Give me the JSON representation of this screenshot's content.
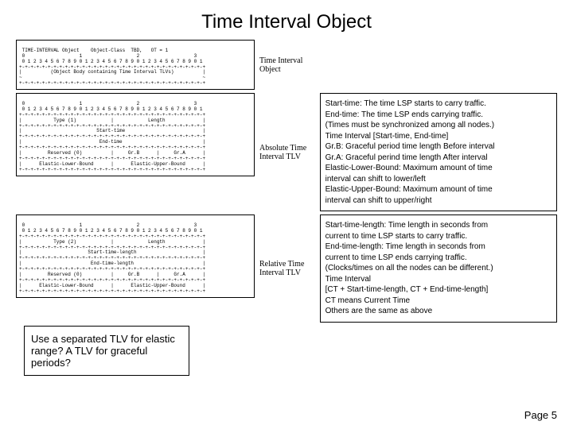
{
  "title": "Time Interval Object",
  "diag1": {
    "header": " TIME-INTERVAL Object    Object-Class  TBD,   OT = 1",
    "ruler1": " 0                   1                   2                   3",
    "ruler2": " 0 1 2 3 4 5 6 7 8 9 0 1 2 3 4 5 6 7 8 9 0 1 2 3 4 5 6 7 8 9 0 1",
    "sep": "+-+-+-+-+-+-+-+-+-+-+-+-+-+-+-+-+-+-+-+-+-+-+-+-+-+-+-+-+-+-+-+-+",
    "body": "|          (Object Body containing Time Interval TLVs)          |",
    "cont": "~                                                               ~",
    "label": "Time Interval\nObject"
  },
  "diag2": {
    "ruler1": " 0                   1                   2                   3",
    "ruler2": " 0 1 2 3 4 5 6 7 8 9 0 1 2 3 4 5 6 7 8 9 0 1 2 3 4 5 6 7 8 9 0 1",
    "sep": "+-+-+-+-+-+-+-+-+-+-+-+-+-+-+-+-+-+-+-+-+-+-+-+-+-+-+-+-+-+-+-+-+",
    "r1": "|           Type (1)            |            Length             |",
    "r2": "|                          Start-time                           |",
    "r3": "|                           End-time                            |",
    "r4": "|         Reserved (0)          |     Gr.B      |     Gr.A      |",
    "r5": "|      Elastic-Lower-Bound      |      Elastic-Upper-Bound      |",
    "label": "Absolute Time\nInterval TLV"
  },
  "note2": "Start-time: The time LSP starts to carry traffic.\nEnd-time: The time LSP ends carrying traffic.\n(Times must be synchronized among all nodes.)\n   Time Interval  [Start-time, End-time]\nGr.B: Graceful period time length Before interval\nGr.A: Graceful perind time length After interval\nElastic-Lower-Bound: Maximum amount of time\ninterval can shift to lower/left\nElastic-Upper-Bound: Maximum amount of time\ninterval can shift to upper/right",
  "diag3": {
    "ruler1": " 0                   1                   2                   3",
    "ruler2": " 0 1 2 3 4 5 6 7 8 9 0 1 2 3 4 5 6 7 8 9 0 1 2 3 4 5 6 7 8 9 0 1",
    "sep": "+-+-+-+-+-+-+-+-+-+-+-+-+-+-+-+-+-+-+-+-+-+-+-+-+-+-+-+-+-+-+-+-+",
    "r1": "|           Type (2)            |            Length             |",
    "r2": "|                       Start-time-length                       |",
    "r3": "|                        End-time-length                        |",
    "r4": "|         Reserved (0)          |     Gr.B      |     Gr.A      |",
    "r5": "|      Elastic-Lower-Bound      |      Elastic-Upper-Bound      |",
    "label": "Relative Time\nInterval TLV"
  },
  "note3": "Start-time-length: Time length in seconds from\ncurrent to time LSP starts to carry traffic.\nEnd-time-length: Time length in seconds from\ncurrent to time LSP ends carrying traffic.\n(Clocks/times on all the nodes can be different.)\nTime Interval\n   [CT + Start-time-length, CT + End-time-length]\nCT means Current Time\nOthers are the same as above",
  "question": "Use a separated TLV for elastic range? A TLV for graceful periods?",
  "page": "Page 5"
}
